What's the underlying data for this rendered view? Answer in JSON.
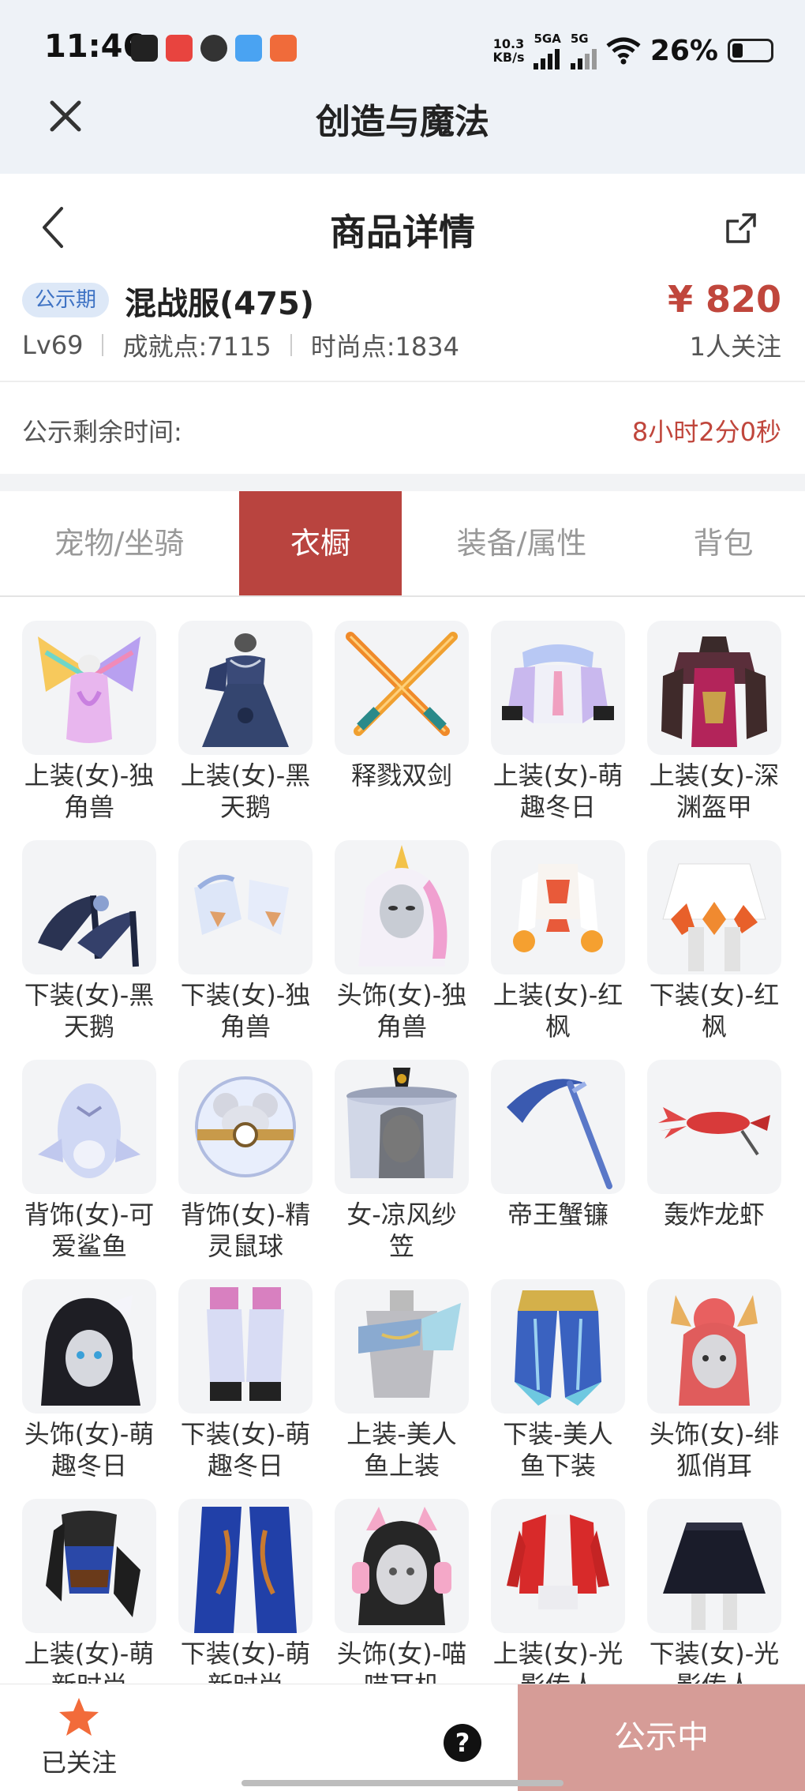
{
  "status_bar": {
    "time": "11:46",
    "speed_value": "10.3",
    "speed_unit": "KB/s",
    "net1": "5GA",
    "net2": "5G",
    "battery": "26%"
  },
  "app_bar": {
    "title": "创造与魔法"
  },
  "detail": {
    "page_title": "商品详情",
    "badge": "公示期",
    "title": "混战服(475)",
    "price": "¥ 820",
    "level": "Lv69",
    "achievement": "成就点:7115",
    "fashion": "时尚点:1834",
    "followers": "1人关注",
    "remain_label": "公示剩余时间:",
    "remain_value": "8小时2分0秒"
  },
  "tabs": [
    {
      "label": "宠物/坐骑",
      "active": false
    },
    {
      "label": "衣橱",
      "active": true
    },
    {
      "label": "装备/属性",
      "active": false
    },
    {
      "label": "背包",
      "active": false
    }
  ],
  "items": [
    {
      "label": "上装(女)-独角兽",
      "icon": "unicorn-top-icon"
    },
    {
      "label": "上装(女)-黑天鹅",
      "icon": "black-swan-dress-icon"
    },
    {
      "label": "释戮双剑",
      "icon": "twin-swords-icon"
    },
    {
      "label": "上装(女)-萌趣冬日",
      "icon": "winter-top-icon"
    },
    {
      "label": "上装(女)-深渊盔甲",
      "icon": "abyss-armor-icon"
    },
    {
      "label": "下装(女)-黑天鹅",
      "icon": "black-swan-heels-icon"
    },
    {
      "label": "下装(女)-独角兽",
      "icon": "unicorn-boots-icon"
    },
    {
      "label": "头饰(女)-独角兽",
      "icon": "unicorn-hood-icon"
    },
    {
      "label": "上装(女)-红枫",
      "icon": "maple-top-icon"
    },
    {
      "label": "下装(女)-红枫",
      "icon": "maple-skirt-icon"
    },
    {
      "label": "背饰(女)-可爱鲨鱼",
      "icon": "shark-backpack-icon"
    },
    {
      "label": "背饰(女)-精灵鼠球",
      "icon": "mouse-ball-icon"
    },
    {
      "label": "女-凉风纱笠",
      "icon": "veil-hat-icon"
    },
    {
      "label": "帝王蟹镰",
      "icon": "crab-scythe-icon"
    },
    {
      "label": "轰炸龙虾",
      "icon": "lobster-icon"
    },
    {
      "label": "头饰(女)-萌趣冬日",
      "icon": "winter-headwear-icon"
    },
    {
      "label": "下装(女)-萌趣冬日",
      "icon": "winter-bottoms-icon"
    },
    {
      "label": "上装-美人鱼上装",
      "icon": "mermaid-top-icon"
    },
    {
      "label": "下装-美人鱼下装",
      "icon": "mermaid-bottom-icon"
    },
    {
      "label": "头饰(女)-绯狐俏耳",
      "icon": "fox-ears-icon"
    },
    {
      "label": "上装(女)-萌新时尚",
      "icon": "blue-corset-icon"
    },
    {
      "label": "下装(女)-萌新时尚",
      "icon": "blue-pants-icon"
    },
    {
      "label": "头饰(女)-喵喵耳机",
      "icon": "cat-headphones-icon"
    },
    {
      "label": "上装(女)-光影传人",
      "icon": "red-jacket-icon"
    },
    {
      "label": "下装(女)-光影传人",
      "icon": "black-skirt-icon"
    }
  ],
  "bottom_bar": {
    "follow_label": "已关注",
    "status_label": "公示中"
  },
  "colors": {
    "accent": "#b9443f",
    "price": "#c0463c",
    "badge_bg": "#dde8f7",
    "badge_text": "#3f73c4",
    "status_button": "#d69c97",
    "star": "#f26b3a"
  }
}
